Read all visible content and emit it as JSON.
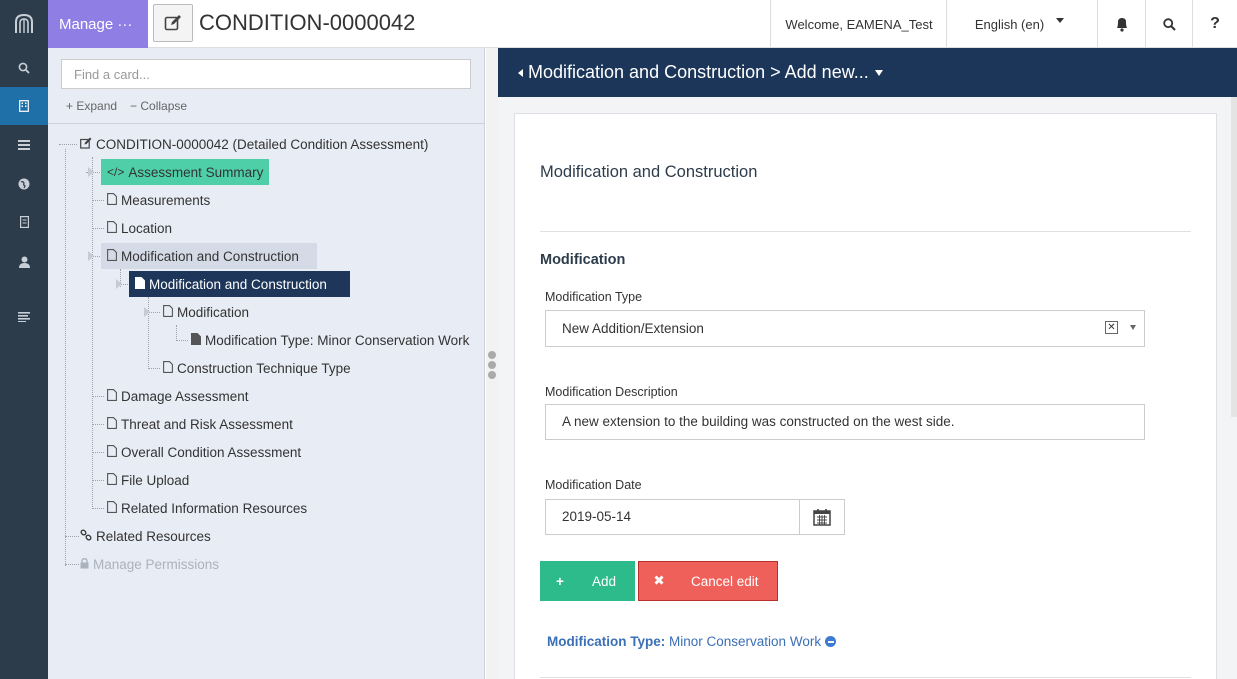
{
  "topbar": {
    "manage_label": "Manage ···",
    "doc_title": "CONDITION-0000042",
    "welcome": "Welcome, EAMENA_Test",
    "language": "English (en)",
    "help": "?"
  },
  "rail": {
    "icons": [
      "app-logo-icon",
      "search-icon",
      "building-icon",
      "list-icon",
      "globe-icon",
      "card-icon",
      "user-icon",
      "menu-icon"
    ]
  },
  "tree": {
    "search_placeholder": "Find a card...",
    "expand": "Expand",
    "collapse": "Collapse",
    "nodes": {
      "root": "CONDITION-0000042 (Detailed Condition Assessment)",
      "assessment_summary": "Assessment Summary",
      "measurements": "Measurements",
      "location": "Location",
      "mod_construction": "Modification and Construction",
      "mod_construction_child": "Modification and Construction",
      "modification": "Modification",
      "modification_type": "Modification Type: Minor Conservation Work",
      "construction_technique": "Construction Technique Type",
      "damage": "Damage Assessment",
      "threat": "Threat and Risk Assessment",
      "overall": "Overall Condition Assessment",
      "file_upload": "File Upload",
      "related_info": "Related Information Resources",
      "related_resources": "Related Resources",
      "manage_permissions": "Manage Permissions"
    }
  },
  "header": {
    "breadcrumb": "Modification and Construction > Add new..."
  },
  "form": {
    "card_title": "Modification and Construction",
    "section_title": "Modification",
    "type_label": "Modification Type",
    "type_value": "New Addition/Extension",
    "desc_label": "Modification Description",
    "desc_value": "A new extension to the building was constructed on the west side.",
    "date_label": "Modification Date",
    "date_value": "2019-05-14",
    "add_label": "Add",
    "cancel_label": "Cancel edit",
    "existing_label": "Modification Type:",
    "existing_value": "Minor Conservation Work"
  },
  "colors": {
    "rail": "#2d3c4b",
    "manage": "#8f7ee3",
    "header_bar": "#1c3659",
    "selected_green": "#4fcfa7",
    "selected_dark": "#1d3659",
    "add": "#2ebb8c",
    "cancel": "#f0605a"
  }
}
